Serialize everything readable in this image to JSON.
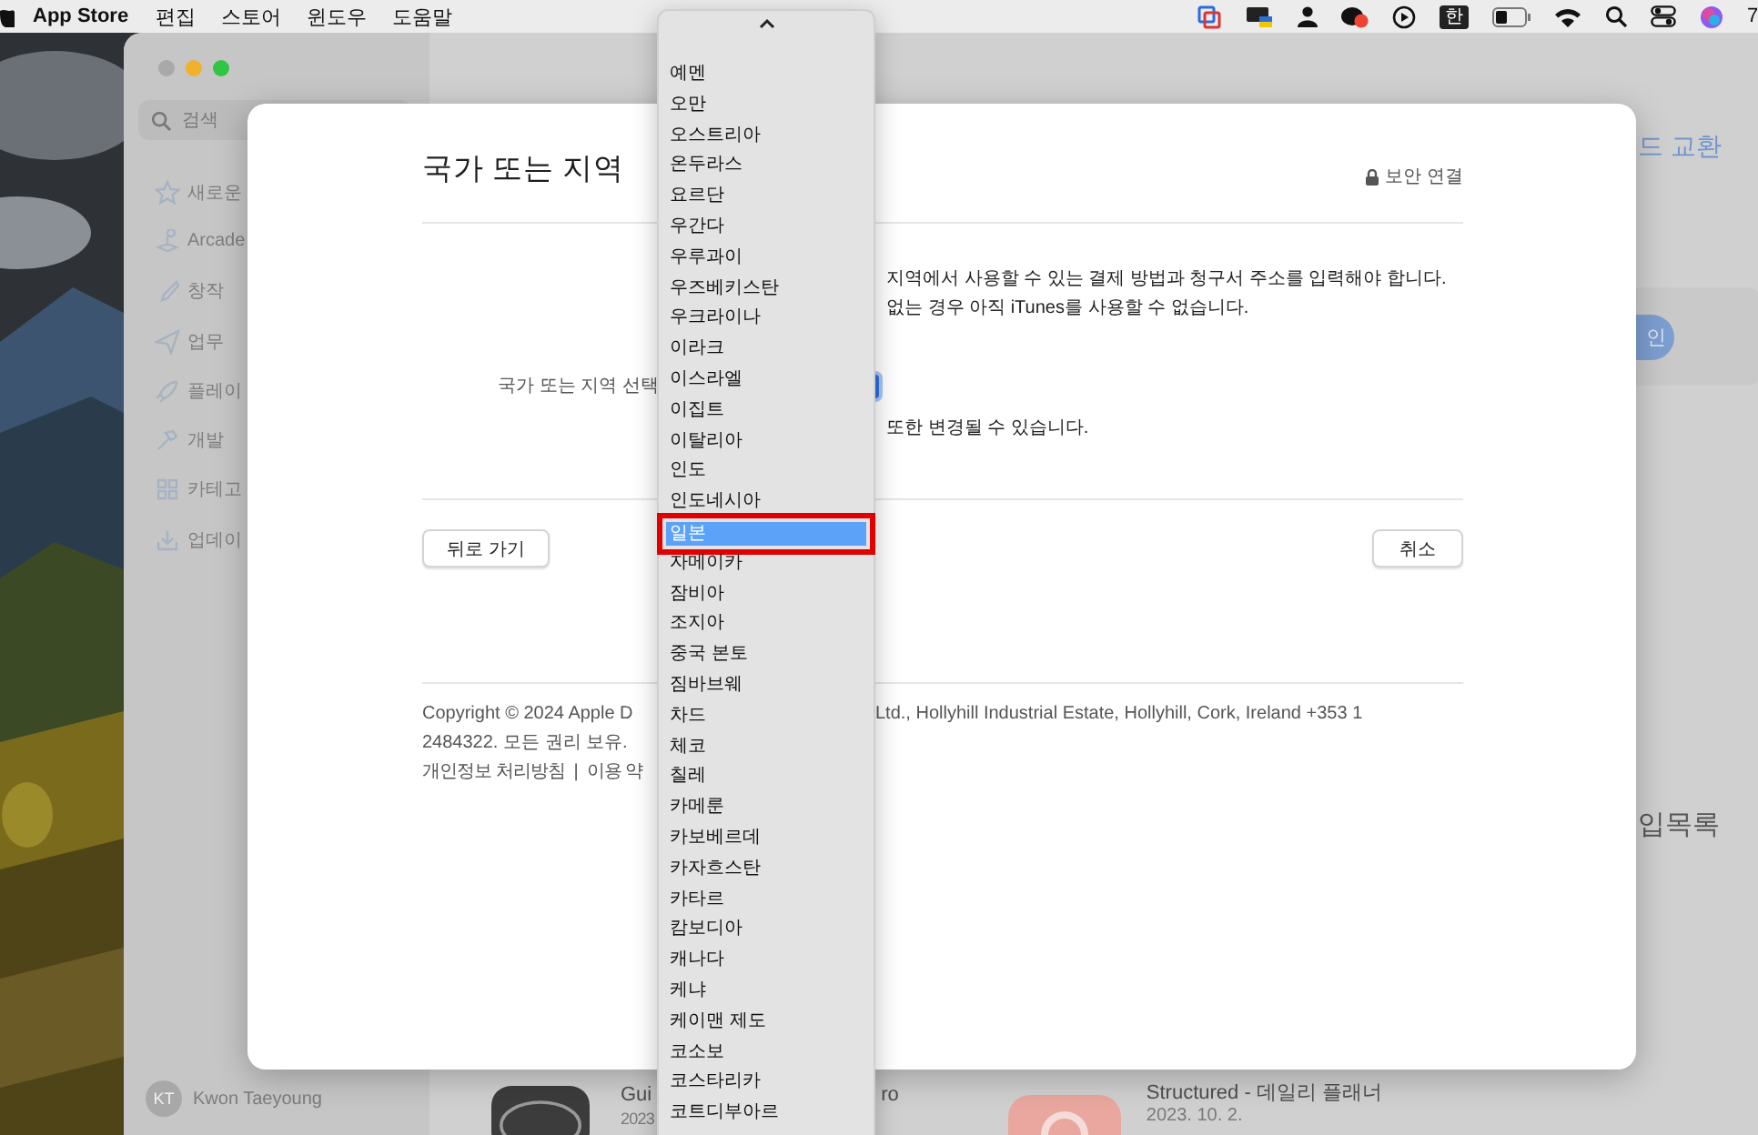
{
  "menubar": {
    "app": "App Store",
    "items": [
      "편집",
      "스토어",
      "윈도우",
      "도움말"
    ],
    "input_source": "한",
    "clock": "7"
  },
  "sidebar": {
    "search": {
      "placeholder": "검색"
    },
    "items": [
      {
        "label": "새로운",
        "kind": "star"
      },
      {
        "label": "Arcade",
        "kind": "joystick"
      },
      {
        "label": "창작",
        "kind": "brush"
      },
      {
        "label": "업무",
        "kind": "plane"
      },
      {
        "label": "플레이",
        "kind": "rocket"
      },
      {
        "label": "개발",
        "kind": "hammer"
      },
      {
        "label": "카테고",
        "kind": "grid"
      },
      {
        "label": "업데이",
        "kind": "download"
      }
    ],
    "user": {
      "initials": "KT",
      "name": "Kwon Taeyoung"
    }
  },
  "main": {
    "link": "드 교환",
    "button": "인",
    "heading": "입목록",
    "apps": [
      {
        "kind": "guitar",
        "name": "Gui",
        "name_tail": "ro",
        "date": "2023"
      },
      {
        "kind": "check",
        "name": "Structured - 데일리 플래너",
        "date": "2023. 10. 2."
      }
    ]
  },
  "dialog": {
    "title": "국가 또는 지역",
    "security": "보안 연결",
    "body_lines": [
      "지역에서 사용할 수 있는 결제 방법과 청구서 주소를 입력해야 합니다.",
      "없는 경우 아직 iTunes를 사용할 수 없습니다."
    ],
    "country_label": "국가 또는 지역 선택",
    "note": "또한 변경될 수 있습니다.",
    "back_button": "뒤로 가기",
    "cancel_button": "취소",
    "copyright_left": [
      "Copyright © 2024 Apple D",
      "2484322. 모든 권리 보유."
    ],
    "copyright_right": "Ltd., Hollyhill Industrial Estate, Hollyhill, Cork, Ireland +353 1",
    "links": [
      "개인정보 처리방침",
      "이용 약"
    ],
    "link_separator": "|"
  },
  "country_menu": {
    "items": [
      {
        "label": "예멘",
        "selected": false
      },
      {
        "label": "오만",
        "selected": false
      },
      {
        "label": "오스트리아",
        "selected": false
      },
      {
        "label": "온두라스",
        "selected": false
      },
      {
        "label": "요르단",
        "selected": false
      },
      {
        "label": "우간다",
        "selected": false
      },
      {
        "label": "우루과이",
        "selected": false
      },
      {
        "label": "우즈베키스탄",
        "selected": false
      },
      {
        "label": "우크라이나",
        "selected": false
      },
      {
        "label": "이라크",
        "selected": false
      },
      {
        "label": "이스라엘",
        "selected": false
      },
      {
        "label": "이집트",
        "selected": false
      },
      {
        "label": "이탈리아",
        "selected": false
      },
      {
        "label": "인도",
        "selected": false
      },
      {
        "label": "인도네시아",
        "selected": false
      },
      {
        "label": "일본",
        "selected": true
      },
      {
        "label": "자메이카",
        "selected": false
      },
      {
        "label": "잠비아",
        "selected": false
      },
      {
        "label": "조지아",
        "selected": false
      },
      {
        "label": "중국 본토",
        "selected": false
      },
      {
        "label": "짐바브웨",
        "selected": false
      },
      {
        "label": "차드",
        "selected": false
      },
      {
        "label": "체코",
        "selected": false
      },
      {
        "label": "칠레",
        "selected": false
      },
      {
        "label": "카메룬",
        "selected": false
      },
      {
        "label": "카보베르데",
        "selected": false
      },
      {
        "label": "카자흐스탄",
        "selected": false
      },
      {
        "label": "카타르",
        "selected": false
      },
      {
        "label": "캄보디아",
        "selected": false
      },
      {
        "label": "캐나다",
        "selected": false
      },
      {
        "label": "케냐",
        "selected": false
      },
      {
        "label": "케이맨 제도",
        "selected": false
      },
      {
        "label": "코소보",
        "selected": false
      },
      {
        "label": "코스타리카",
        "selected": false
      },
      {
        "label": "코트디부아르",
        "selected": false
      }
    ]
  }
}
